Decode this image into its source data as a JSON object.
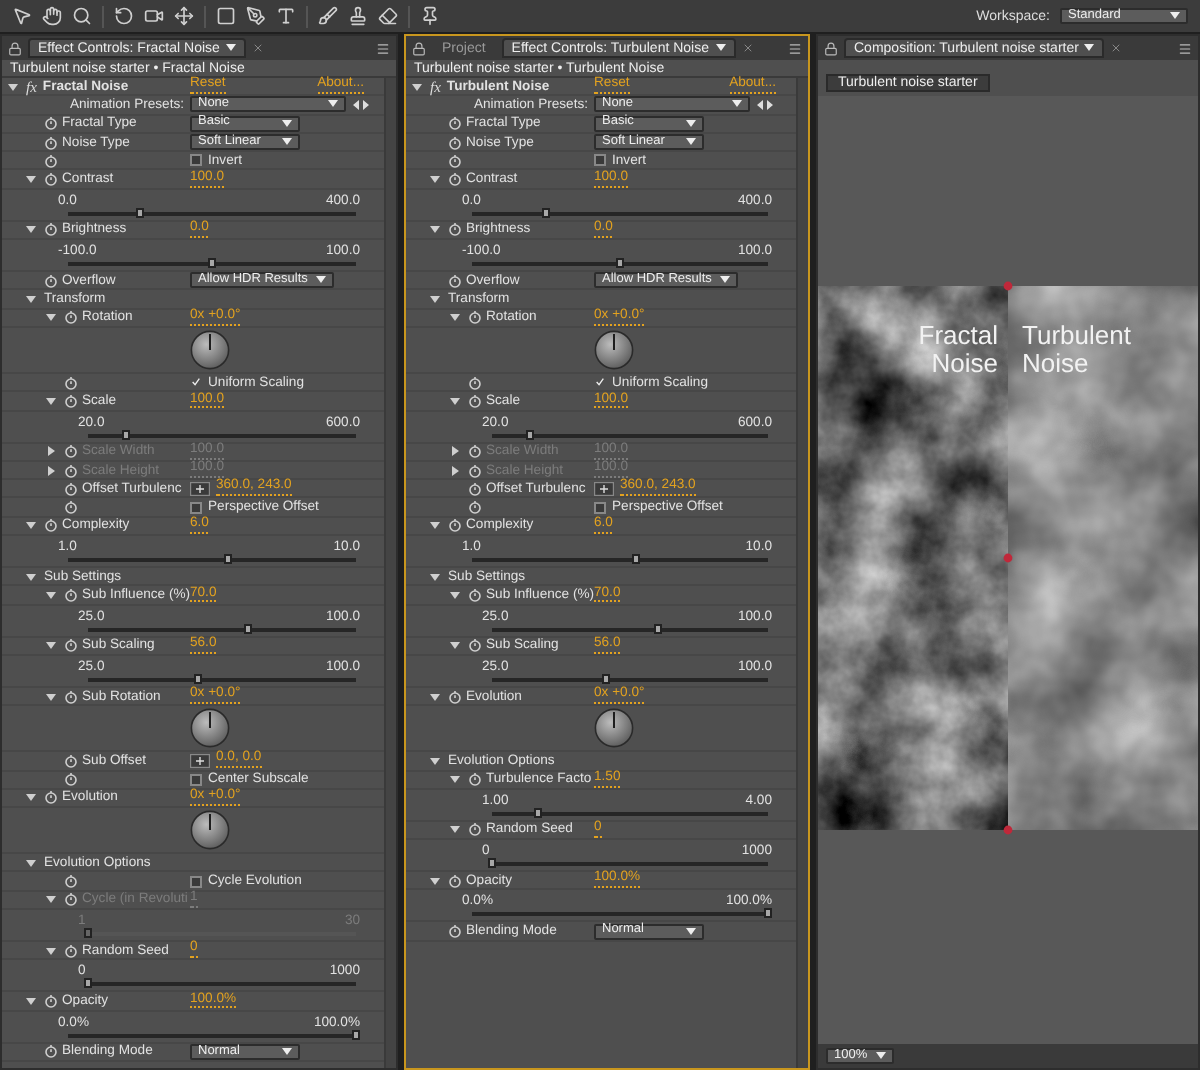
{
  "toolbar": {
    "workspace_label": "Workspace:",
    "workspace": "Standard"
  },
  "panels": [
    {
      "focused": false,
      "tabs": [
        {
          "label": "Effect Controls: Fractal Noise",
          "selected": true,
          "menu": true
        }
      ],
      "breadcrumb": "Turbulent noise starter • Fractal Noise",
      "effect": {
        "badge": "fx",
        "name": "Fractal Noise",
        "reset": "Reset",
        "about": "About...",
        "expanded": true,
        "rows": [
          {
            "kind": "preset",
            "label": "Animation Presets:",
            "value": "None"
          },
          {
            "kind": "dropdown",
            "label": "Fractal Type",
            "value": "Basic"
          },
          {
            "kind": "dropdown",
            "label": "Noise Type",
            "value": "Soft Linear"
          },
          {
            "kind": "checkbox",
            "text": "Invert",
            "checked": false
          },
          {
            "kind": "slider",
            "label": "Contrast",
            "value": "100.0",
            "expanded": true,
            "min": "0.0",
            "max": "400.0",
            "level": 0.25
          },
          {
            "kind": "slider",
            "label": "Brightness",
            "value": "0.0",
            "expanded": true,
            "min": "-100.0",
            "max": "100.0",
            "level": 0.5
          },
          {
            "kind": "dropdown",
            "label": "Overflow",
            "value": "Allow HDR Results"
          },
          {
            "kind": "group",
            "label": "Transform",
            "expanded": true,
            "children": [
              {
                "kind": "angle",
                "label": "Rotation",
                "value": "0x +0.0°",
                "expanded": true
              },
              {
                "kind": "checkbox",
                "text": "Uniform Scaling",
                "checked": true
              },
              {
                "kind": "slider",
                "label": "Scale",
                "value": "100.0",
                "expanded": true,
                "min": "20.0",
                "max": "600.0",
                "level": 0.14
              },
              {
                "kind": "value",
                "label": "Scale Width",
                "value": "100.0",
                "expanded": false,
                "disabled": true
              },
              {
                "kind": "value",
                "label": "Scale Height",
                "value": "100.0",
                "expanded": false,
                "disabled": true
              },
              {
                "kind": "point",
                "label": "Offset Turbulenc",
                "value": "360.0, 243.0"
              },
              {
                "kind": "checkbox",
                "text": "Perspective Offset",
                "checked": false
              }
            ]
          },
          {
            "kind": "slider",
            "label": "Complexity",
            "value": "6.0",
            "expanded": true,
            "min": "1.0",
            "max": "10.0",
            "level": 0.556
          },
          {
            "kind": "group",
            "label": "Sub Settings",
            "expanded": true,
            "children": [
              {
                "kind": "slider",
                "label": "Sub Influence (%)",
                "value": "70.0",
                "expanded": true,
                "min": "25.0",
                "max": "100.0",
                "level": 0.6
              },
              {
                "kind": "slider",
                "label": "Sub Scaling",
                "value": "56.0",
                "expanded": true,
                "min": "25.0",
                "max": "100.0",
                "level": 0.41
              },
              {
                "kind": "angle",
                "label": "Sub Rotation",
                "value": "0x +0.0°",
                "expanded": true
              },
              {
                "kind": "point",
                "label": "Sub Offset",
                "value": "0.0, 0.0"
              },
              {
                "kind": "checkbox",
                "text": "Center Subscale",
                "checked": false
              }
            ]
          },
          {
            "kind": "angle",
            "label": "Evolution",
            "value": "0x +0.0°",
            "expanded": true
          },
          {
            "kind": "group",
            "label": "Evolution Options",
            "expanded": true,
            "children": [
              {
                "kind": "checkbox",
                "text": "Cycle Evolution",
                "checked": false
              },
              {
                "kind": "slider",
                "label": "Cycle (in Revoluti",
                "value": "1",
                "expanded": true,
                "disabled": true,
                "min": "1",
                "max": "30",
                "level": 0
              },
              {
                "kind": "slider",
                "label": "Random Seed",
                "value": "0",
                "expanded": true,
                "min": "0",
                "max": "1000",
                "level": 0
              }
            ]
          },
          {
            "kind": "slider",
            "label": "Opacity",
            "value": "100.0%",
            "expanded": true,
            "min": "0.0%",
            "max": "100.0%",
            "level": 1
          },
          {
            "kind": "dropdown",
            "label": "Blending Mode",
            "value": "Normal"
          }
        ]
      }
    },
    {
      "focused": true,
      "tabs": [
        {
          "label": "Project",
          "selected": false,
          "menu": false
        },
        {
          "label": "Effect Controls: Turbulent Noise",
          "selected": true,
          "menu": true
        }
      ],
      "breadcrumb": "Turbulent noise starter • Turbulent Noise",
      "effect": {
        "badge": "fx",
        "name": "Turbulent Noise",
        "reset": "Reset",
        "about": "About...",
        "expanded": true,
        "rows": [
          {
            "kind": "preset",
            "label": "Animation Presets:",
            "value": "None"
          },
          {
            "kind": "dropdown",
            "label": "Fractal Type",
            "value": "Basic"
          },
          {
            "kind": "dropdown",
            "label": "Noise Type",
            "value": "Soft Linear"
          },
          {
            "kind": "checkbox",
            "text": "Invert",
            "checked": false
          },
          {
            "kind": "slider",
            "label": "Contrast",
            "value": "100.0",
            "expanded": true,
            "min": "0.0",
            "max": "400.0",
            "level": 0.25
          },
          {
            "kind": "slider",
            "label": "Brightness",
            "value": "0.0",
            "expanded": true,
            "min": "-100.0",
            "max": "100.0",
            "level": 0.5
          },
          {
            "kind": "dropdown",
            "label": "Overflow",
            "value": "Allow HDR Results"
          },
          {
            "kind": "group",
            "label": "Transform",
            "expanded": true,
            "children": [
              {
                "kind": "angle",
                "label": "Rotation",
                "value": "0x +0.0°",
                "expanded": true
              },
              {
                "kind": "checkbox",
                "text": "Uniform Scaling",
                "checked": true
              },
              {
                "kind": "slider",
                "label": "Scale",
                "value": "100.0",
                "expanded": true,
                "min": "20.0",
                "max": "600.0",
                "level": 0.14
              },
              {
                "kind": "value",
                "label": "Scale Width",
                "value": "100.0",
                "expanded": false,
                "disabled": true
              },
              {
                "kind": "value",
                "label": "Scale Height",
                "value": "100.0",
                "expanded": false,
                "disabled": true
              },
              {
                "kind": "point",
                "label": "Offset Turbulenc",
                "value": "360.0, 243.0"
              },
              {
                "kind": "checkbox",
                "text": "Perspective Offset",
                "checked": false
              }
            ]
          },
          {
            "kind": "slider",
            "label": "Complexity",
            "value": "6.0",
            "expanded": true,
            "min": "1.0",
            "max": "10.0",
            "level": 0.556
          },
          {
            "kind": "group",
            "label": "Sub Settings",
            "expanded": true,
            "children": [
              {
                "kind": "slider",
                "label": "Sub Influence (%)",
                "value": "70.0",
                "expanded": true,
                "min": "25.0",
                "max": "100.0",
                "level": 0.6
              },
              {
                "kind": "slider",
                "label": "Sub Scaling",
                "value": "56.0",
                "expanded": true,
                "min": "25.0",
                "max": "100.0",
                "level": 0.41
              }
            ]
          },
          {
            "kind": "angle",
            "label": "Evolution",
            "value": "0x +0.0°",
            "expanded": true
          },
          {
            "kind": "group",
            "label": "Evolution Options",
            "expanded": true,
            "children": [
              {
                "kind": "slider",
                "label": "Turbulence Facto",
                "value": "1.50",
                "expanded": true,
                "min": "1.00",
                "max": "4.00",
                "level": 0.167
              },
              {
                "kind": "slider",
                "label": "Random Seed",
                "value": "0",
                "expanded": true,
                "min": "0",
                "max": "1000",
                "level": 0
              }
            ]
          },
          {
            "kind": "slider",
            "label": "Opacity",
            "value": "100.0%",
            "expanded": true,
            "min": "0.0%",
            "max": "100.0%",
            "level": 1
          },
          {
            "kind": "dropdown",
            "label": "Blending Mode",
            "value": "Normal"
          }
        ]
      }
    }
  ],
  "composition": {
    "focused": false,
    "tabs": [
      {
        "label": "Composition: Turbulent noise starter",
        "selected": true,
        "menu": true
      }
    ],
    "comp_button": "Turbulent noise starter",
    "labels": [
      "Fractal Noise",
      "Turbulent Noise"
    ],
    "zoom": "100%"
  }
}
